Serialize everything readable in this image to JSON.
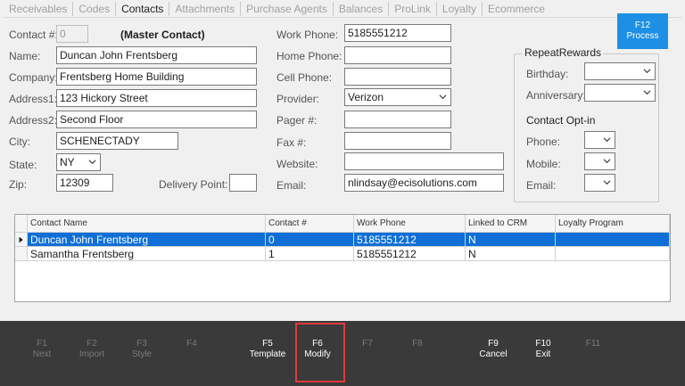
{
  "tabs": [
    {
      "label": "Receivables",
      "active": false
    },
    {
      "label": "Codes",
      "active": false
    },
    {
      "label": "Contacts",
      "active": true
    },
    {
      "label": "Attachments",
      "active": false
    },
    {
      "label": "Purchase Agents",
      "active": false
    },
    {
      "label": "Balances",
      "active": false
    },
    {
      "label": "ProLink",
      "active": false
    },
    {
      "label": "Loyalty",
      "active": false
    },
    {
      "label": "Ecommerce",
      "active": false
    }
  ],
  "form": {
    "contact_no_label": "Contact #:",
    "contact_no_value": "0",
    "master_contact": "(Master Contact)",
    "name_label": "Name:",
    "name_value": "Duncan John Frentsberg",
    "company_label": "Company:",
    "company_value": "Frentsberg Home Building",
    "address1_label": "Address1:",
    "address1_value": "123 Hickory Street",
    "address2_label": "Address2:",
    "address2_value": "Second Floor",
    "city_label": "City:",
    "city_value": "SCHENECTADY",
    "state_label": "State:",
    "state_value": "NY",
    "zip_label": "Zip:",
    "zip_value": "12309",
    "delivery_point_label": "Delivery Point:",
    "delivery_point_value": "",
    "work_phone_label": "Work Phone:",
    "work_phone_value": "5185551212",
    "home_phone_label": "Home Phone:",
    "home_phone_value": "",
    "cell_phone_label": "Cell Phone:",
    "cell_phone_value": "",
    "provider_label": "Provider:",
    "provider_value": "Verizon",
    "pager_label": "Pager #:",
    "pager_value": "",
    "fax_label": "Fax #:",
    "fax_value": "",
    "website_label": "Website:",
    "website_value": "",
    "email_label": "Email:",
    "email_value": "nlindsay@ecisolutions.com"
  },
  "repeat_rewards": {
    "title": "RepeatRewards",
    "birthday_label": "Birthday:",
    "anniversary_label": "Anniversary:",
    "opt_in_title": "Contact Opt-in",
    "phone_label": "Phone:",
    "mobile_label": "Mobile:",
    "email_label": "Email:"
  },
  "grid": {
    "columns": [
      "Contact Name",
      "Contact #",
      "Work Phone",
      "Linked to CRM",
      "Loyalty Program"
    ],
    "rows": [
      {
        "name": "Duncan John Frentsberg",
        "contact_no": "0",
        "work_phone": "5185551212",
        "crm": "N",
        "loyalty": "",
        "selected": true
      },
      {
        "name": "Samantha Frentsberg",
        "contact_no": "1",
        "work_phone": "5185551212",
        "crm": "N",
        "loyalty": "",
        "selected": false
      }
    ]
  },
  "function_keys": {
    "f1": {
      "key": "F1",
      "label": "Next"
    },
    "f2": {
      "key": "F2",
      "label": "Import"
    },
    "f3": {
      "key": "F3",
      "label": "Style"
    },
    "f4": {
      "key": "F4",
      "label": ""
    },
    "f5": {
      "key": "F5",
      "label": "Template"
    },
    "f6": {
      "key": "F6",
      "label": "Modify"
    },
    "f7": {
      "key": "F7",
      "label": ""
    },
    "f8": {
      "key": "F8",
      "label": ""
    },
    "f9": {
      "key": "F9",
      "label": "Cancel"
    },
    "f10": {
      "key": "F10",
      "label": "Exit"
    },
    "f11": {
      "key": "F11",
      "label": ""
    },
    "f12": {
      "key": "F12",
      "label": "Process"
    }
  },
  "colors": {
    "selected_row": "#0f6fd6",
    "process_button": "#1e90e4",
    "highlight": "#e0393e",
    "footer": "#3a3a3a"
  }
}
